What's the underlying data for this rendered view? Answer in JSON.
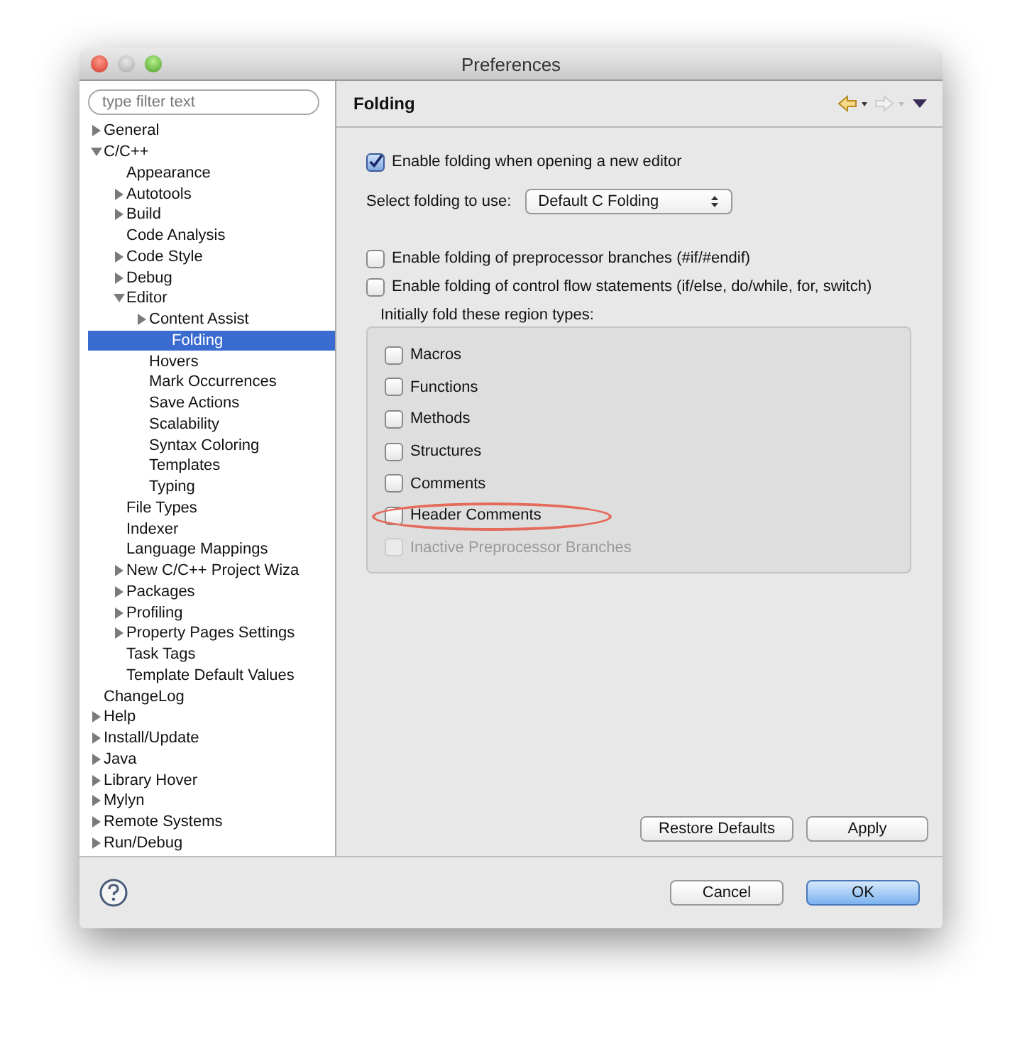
{
  "window": {
    "title": "Preferences"
  },
  "filter": {
    "placeholder": "type filter text"
  },
  "tree": [
    {
      "label": "General",
      "expanded": false,
      "selected": false
    },
    {
      "label": "C/C++",
      "expanded": true,
      "selected": false,
      "children": [
        {
          "label": "Appearance",
          "selected": false
        },
        {
          "label": "Autotools",
          "expanded": false,
          "selected": false
        },
        {
          "label": "Build",
          "expanded": false,
          "selected": false
        },
        {
          "label": "Code Analysis",
          "selected": false
        },
        {
          "label": "Code Style",
          "expanded": false,
          "selected": false
        },
        {
          "label": "Debug",
          "expanded": false,
          "selected": false
        },
        {
          "label": "Editor",
          "expanded": true,
          "selected": false,
          "children": [
            {
              "label": "Content Assist",
              "expanded": false,
              "selected": false
            },
            {
              "label": "Folding",
              "selected": true
            },
            {
              "label": "Hovers",
              "selected": false
            },
            {
              "label": "Mark Occurrences",
              "selected": false
            },
            {
              "label": "Save Actions",
              "selected": false
            },
            {
              "label": "Scalability",
              "selected": false
            },
            {
              "label": "Syntax Coloring",
              "selected": false
            },
            {
              "label": "Templates",
              "selected": false
            },
            {
              "label": "Typing",
              "selected": false
            }
          ]
        },
        {
          "label": "File Types",
          "selected": false
        },
        {
          "label": "Indexer",
          "selected": false
        },
        {
          "label": "Language Mappings",
          "selected": false
        },
        {
          "label": "New C/C++ Project Wiza",
          "expanded": false,
          "selected": false
        },
        {
          "label": "Packages",
          "expanded": false,
          "selected": false
        },
        {
          "label": "Profiling",
          "expanded": false,
          "selected": false
        },
        {
          "label": "Property Pages Settings",
          "expanded": false,
          "selected": false
        },
        {
          "label": "Task Tags",
          "selected": false
        },
        {
          "label": "Template Default Values",
          "selected": false
        }
      ]
    },
    {
      "label": "ChangeLog",
      "selected": false
    },
    {
      "label": "Help",
      "expanded": false,
      "selected": false
    },
    {
      "label": "Install/Update",
      "expanded": false,
      "selected": false
    },
    {
      "label": "Java",
      "expanded": false,
      "selected": false
    },
    {
      "label": "Library Hover",
      "expanded": false,
      "selected": false
    },
    {
      "label": "Mylyn",
      "expanded": false,
      "selected": false
    },
    {
      "label": "Remote Systems",
      "expanded": false,
      "selected": false
    },
    {
      "label": "Run/Debug",
      "expanded": false,
      "selected": false
    }
  ],
  "page": {
    "title": "Folding",
    "enable_option": {
      "label": "Enable folding when opening a new editor",
      "checked": true
    },
    "folding_select": {
      "label": "Select folding to use:",
      "value": "Default C Folding"
    },
    "options": [
      {
        "label": "Enable folding of preprocessor branches (#if/#endif)",
        "checked": false
      },
      {
        "label": "Enable folding of control flow statements (if/else, do/while, for, switch)",
        "checked": false
      }
    ],
    "group": {
      "label": "Initially fold these region types:",
      "items": [
        {
          "label": "Macros",
          "checked": false,
          "disabled": false,
          "highlighted": false
        },
        {
          "label": "Functions",
          "checked": false,
          "disabled": false,
          "highlighted": false
        },
        {
          "label": "Methods",
          "checked": false,
          "disabled": false,
          "highlighted": false
        },
        {
          "label": "Structures",
          "checked": false,
          "disabled": false,
          "highlighted": false
        },
        {
          "label": "Comments",
          "checked": false,
          "disabled": false,
          "highlighted": false
        },
        {
          "label": "Header Comments",
          "checked": false,
          "disabled": false,
          "highlighted": true
        },
        {
          "label": "Inactive Preprocessor Branches",
          "checked": false,
          "disabled": true,
          "highlighted": false
        }
      ]
    },
    "buttons": [
      "Restore Defaults",
      "Apply"
    ]
  },
  "footer": {
    "buttons": [
      {
        "label": "Cancel",
        "default": false
      },
      {
        "label": "OK",
        "default": true
      }
    ]
  }
}
